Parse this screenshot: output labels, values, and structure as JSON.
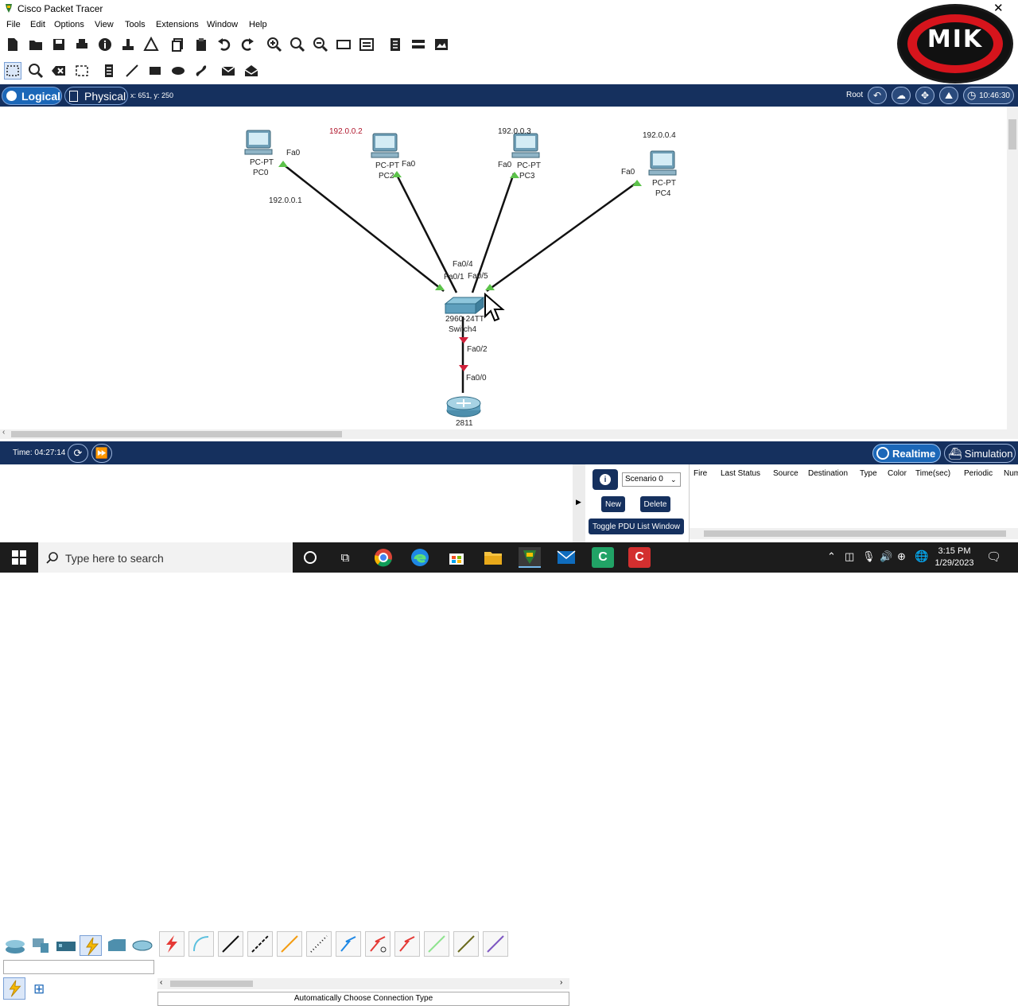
{
  "window": {
    "title": "Cisco Packet Tracer"
  },
  "menu": [
    "File",
    "Edit",
    "Options",
    "View",
    "Tools",
    "Extensions",
    "Window",
    "Help"
  ],
  "logo": {
    "text": "MIK"
  },
  "modebar": {
    "logical_label": "Logical",
    "physical_label": "Physical",
    "coords": "x: 651, y: 250",
    "root_label": "Root",
    "clock": "10:46:30"
  },
  "topology": {
    "devices": [
      {
        "id": "pc0",
        "type_label": "PC-PT",
        "name": "PC0"
      },
      {
        "id": "pc2",
        "type_label": "PC-PT",
        "name": "PC2"
      },
      {
        "id": "pc3",
        "type_label": "PC-PT",
        "name": "PC3"
      },
      {
        "id": "pc4",
        "type_label": "PC-PT",
        "name": "PC4"
      },
      {
        "id": "switch4",
        "type_label": "2960-24TT",
        "name": "Switch4"
      },
      {
        "id": "router",
        "type_label": "2811",
        "name": ""
      }
    ],
    "ip_labels": {
      "pc0": "192.0.0.1",
      "pc2": "192.0.0.2",
      "pc3": "192.0.0.3",
      "pc4": "192.0.0.4"
    },
    "port_labels": {
      "pc0_fa0": "Fa0",
      "pc2_fa0": "Fa0",
      "pc3_fa0": "Fa0",
      "pc4_fa0": "Fa0",
      "sw_fa04": "Fa0/4",
      "sw_fa01": "Fa0/1",
      "sw_fa05": "Fa0/5",
      "sw_fa02": "Fa0/2",
      "rt_fa00": "Fa0/0"
    },
    "link_colors": {
      "up": "#5cc24a",
      "down": "#d0203a"
    }
  },
  "timebar": {
    "time": "Time: 04:27:14",
    "realtime_label": "Realtime",
    "simulation_label": "Simulation"
  },
  "device_panel": {
    "status_text": "Automatically Choose Connection Type"
  },
  "pdu": {
    "scenario": "Scenario 0",
    "new_label": "New",
    "delete_label": "Delete",
    "toggle_label": "Toggle PDU List Window",
    "columns": [
      "Fire",
      "Last Status",
      "Source",
      "Destination",
      "Type",
      "Color",
      "Time(sec)",
      "Periodic",
      "Num"
    ]
  },
  "taskbar": {
    "search_placeholder": "Type here to search",
    "time": "3:15 PM",
    "date": "1/29/2023"
  }
}
